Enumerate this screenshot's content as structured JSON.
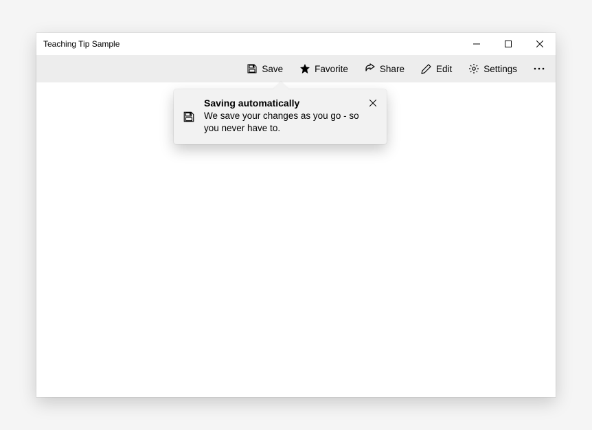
{
  "window": {
    "title": "Teaching Tip Sample"
  },
  "toolbar": {
    "save_label": "Save",
    "favorite_label": "Favorite",
    "share_label": "Share",
    "edit_label": "Edit",
    "settings_label": "Settings"
  },
  "teaching_tip": {
    "title": "Saving automatically",
    "subtitle": "We save your changes as you go - so you never have to."
  }
}
